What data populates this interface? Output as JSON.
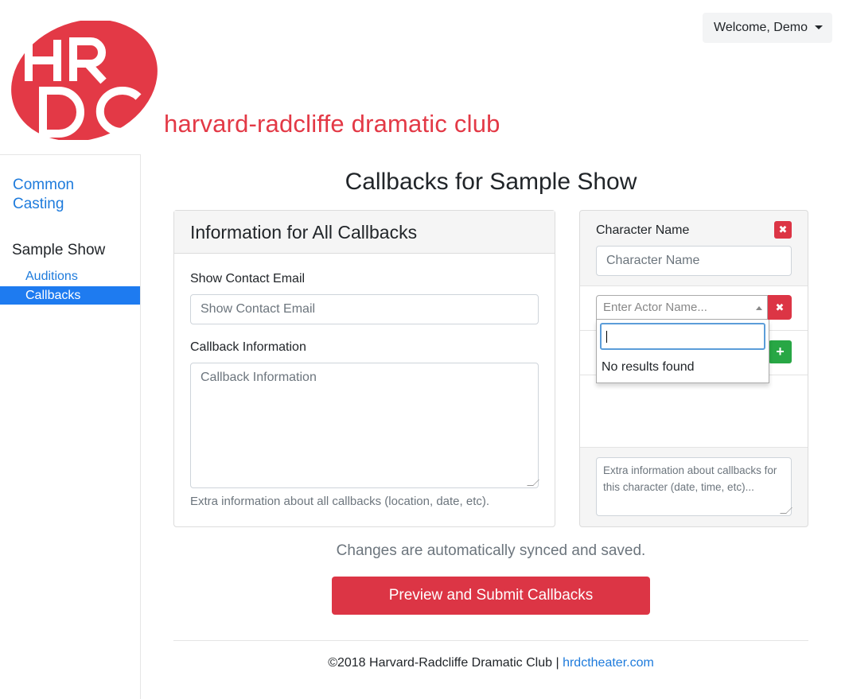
{
  "header": {
    "logo_letters": "HRDC",
    "logo_text": "harvard-radcliffe dramatic club",
    "welcome_label": "Welcome, Demo",
    "brand_color": "#e33946"
  },
  "sidebar": {
    "common_casting": "Common Casting",
    "show_name": "Sample Show",
    "items": [
      {
        "label": "Auditions",
        "active": false
      },
      {
        "label": "Callbacks",
        "active": true
      }
    ]
  },
  "main": {
    "title": "Callbacks for Sample Show",
    "info_card": {
      "header": "Information for All Callbacks",
      "email_label": "Show Contact Email",
      "email_placeholder": "Show Contact Email",
      "info_label": "Callback Information",
      "info_placeholder": "Callback Information",
      "help_text": "Extra information about all callbacks (location, date, etc)."
    },
    "character_card": {
      "name_label": "Character Name",
      "name_placeholder": "Character Name",
      "actor_placeholder": "Enter Actor Name...",
      "no_results": "No results found",
      "extra_placeholder": "Extra information about callbacks for this character (date, time, etc)..."
    },
    "sync_text": "Changes are automatically synced and saved.",
    "submit_label": "Preview and Submit Callbacks"
  },
  "footer": {
    "copyright": "©2018 Harvard-Radcliffe Dramatic Club |",
    "link_text": "hrdctheater.com"
  },
  "colors": {
    "danger": "#dc3545",
    "success": "#28a745",
    "link": "#1e7bdc",
    "active": "#1e7bf0"
  }
}
